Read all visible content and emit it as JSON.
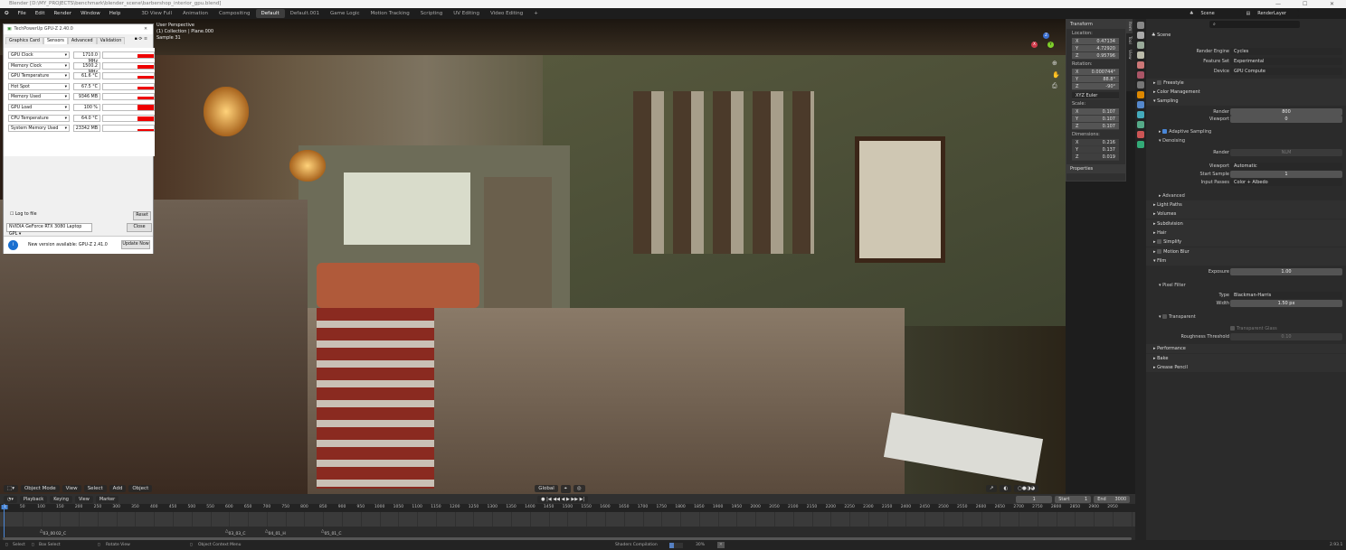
{
  "window_title": "Blender [D:\\MY_PROJECTS\\benchmark\\blender_scene\\barbershop_interior_gpu.blend]",
  "menu": [
    "File",
    "Edit",
    "Render",
    "Window",
    "Help"
  ],
  "workspaces": [
    "3D View Full",
    "Animation",
    "Compositing",
    "Default",
    "Default.001",
    "Game Logic",
    "Motion Tracking",
    "Scripting",
    "UV Editing",
    "Video Editing",
    "+"
  ],
  "active_workspace": "Default",
  "viewport": {
    "overlay": [
      "User Perspective",
      "(1) Collection | Plane.000",
      "Sample 31"
    ],
    "header": {
      "editor": "Object Mode",
      "items": [
        "View",
        "Select",
        "Add",
        "Object"
      ],
      "orientation": "Global"
    },
    "gizmo": {
      "x": "X",
      "y": "Y",
      "z": "Z"
    }
  },
  "gpuz": {
    "title": "TechPowerUp GPU-Z 2.40.0",
    "tabs": [
      "Graphics Card",
      "Sensors",
      "Advanced",
      "Validation"
    ],
    "active_tab": "Sensors",
    "sensors": [
      {
        "name": "GPU Clock",
        "value": "1710.0 MHz",
        "level": 0.7
      },
      {
        "name": "Memory Clock",
        "value": "1500.2 MHz",
        "level": 0.6
      },
      {
        "name": "GPU Temperature",
        "value": "61.6 °C",
        "level": 0.5
      },
      {
        "name": "Hot Spot",
        "value": "67.5 °C",
        "level": 0.55
      },
      {
        "name": "Memory Used",
        "value": "9346 MB",
        "level": 0.6
      },
      {
        "name": "GPU Load",
        "value": "100 %",
        "level": 1.0
      },
      {
        "name": "CPU Temperature",
        "value": "64.0 °C",
        "level": 0.8
      },
      {
        "name": "System Memory Used",
        "value": "23342 MB",
        "level": 0.3
      }
    ],
    "log_label": "Log to file",
    "reset": "Reset",
    "device": "NVIDIA GeForce RTX 3080 Laptop GPL",
    "close": "Close",
    "update_msg": "New version available: GPU-Z 2.41.0",
    "update_btn": "Update Now"
  },
  "npanel": {
    "title": "Transform",
    "location_label": "Location:",
    "location": [
      [
        "X",
        "0.47134"
      ],
      [
        "Y",
        "4.72920"
      ],
      [
        "Z",
        "0.95796"
      ]
    ],
    "rotation_label": "Rotation:",
    "rotation": [
      [
        "X",
        "0.000744°"
      ],
      [
        "Y",
        "88.8°"
      ],
      [
        "Z",
        "-90°"
      ]
    ],
    "rot_mode": "XYZ Euler",
    "scale_label": "Scale:",
    "scale": [
      [
        "X",
        "0.107"
      ],
      [
        "Y",
        "0.107"
      ],
      [
        "Z",
        "0.107"
      ]
    ],
    "dimensions_label": "Dimensions:",
    "dimensions": [
      [
        "X",
        "0.216"
      ],
      [
        "Y",
        "0.137"
      ],
      [
        "Z",
        "0.019"
      ]
    ],
    "properties": "Properties",
    "tabs": [
      "Item",
      "Tool",
      "View"
    ]
  },
  "props": {
    "scene": "Scene",
    "view_layer": "RenderLayer",
    "context": "Scene",
    "render_engine_label": "Render Engine",
    "render_engine": "Cycles",
    "feature_set_label": "Feature Set",
    "feature_set": "Experimental",
    "device_label": "Device",
    "device": "GPU Compute",
    "freestyle": "Freestyle",
    "color_management": "Color Management",
    "sampling": "Sampling",
    "render_label": "Render",
    "render_samples": "800",
    "viewport_label": "Viewport",
    "viewport_samples": "0",
    "adaptive": "Adaptive Sampling",
    "denoising": "Denoising",
    "den_render_label": "Render",
    "den_render": "NLM",
    "den_viewport_label": "Viewport",
    "den_viewport": "Automatic",
    "start_sample_label": "Start Sample",
    "start_sample": "1",
    "input_passes_label": "Input Passes",
    "input_passes": "Color + Albedo",
    "advanced": "Advanced",
    "sections": [
      "Light Paths",
      "Volumes",
      "Subdivision",
      "Hair",
      "Simplify",
      "Motion Blur"
    ],
    "film": "Film",
    "exposure_label": "Exposure",
    "exposure": "1.00",
    "pixel_filter": "Pixel Filter",
    "type_label": "Type",
    "type": "Blackman-Harris",
    "width_label": "Width",
    "width": "1.50 px",
    "transparent": "Transparent",
    "transparent_glass": "Transparent Glass",
    "roughness_label": "Roughness Threshold",
    "roughness": "0.10",
    "tail": [
      "Performance",
      "Bake",
      "Grease Pencil"
    ]
  },
  "timeline": {
    "menus": [
      "Playback",
      "Keying",
      "View",
      "Marker"
    ],
    "current_frame": "1",
    "start_label": "Start",
    "start": "1",
    "end_label": "End",
    "end": "3000",
    "ticks_start": 50,
    "ticks_end": 2950,
    "ticks_step": 50,
    "first": "1",
    "markers": [
      "03_00",
      "02_C",
      "03_03_C",
      "04_01_H",
      "05_01_C"
    ]
  },
  "status": {
    "select": "Select",
    "box_select": "Box Select",
    "rotate": "Rotate View",
    "context": "Object Context Menu",
    "job": "Shaders Compilation",
    "progress": 0.3,
    "progress_text": "30%",
    "version": "2.93.1"
  }
}
